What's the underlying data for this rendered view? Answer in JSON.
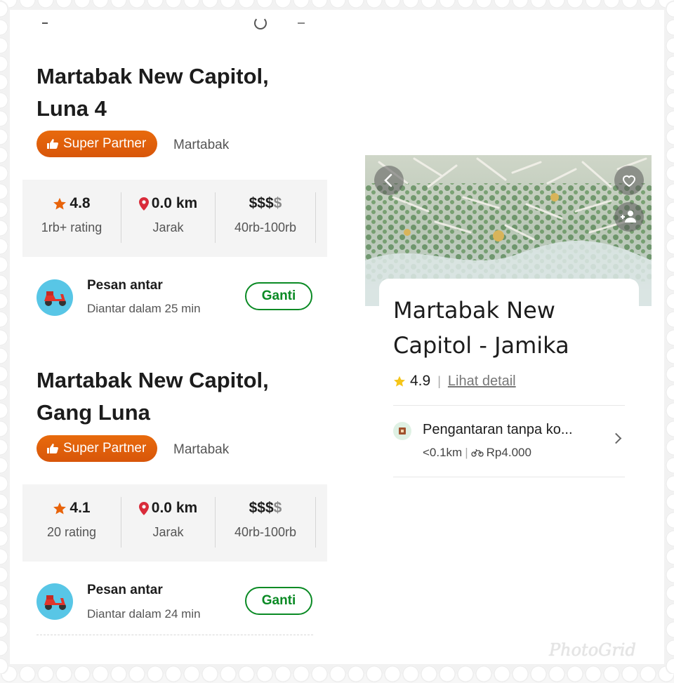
{
  "left_panel": {
    "restaurants": [
      {
        "title": "Martabak New Capitol, Luna 4",
        "badge": "Super Partner",
        "category": "Martabak",
        "rating_value": "4.8",
        "rating_label": "1rb+ rating",
        "distance_value": "0.0 km",
        "distance_label": "Jarak",
        "price_strong": "$$$",
        "price_dim": "$",
        "price_label": "40rb-100rb",
        "delivery_title": "Pesan antar",
        "delivery_sub": "Diantar dalam 25 min",
        "change_button": "Ganti"
      },
      {
        "title": "Martabak New Capitol, Gang Luna",
        "badge": "Super Partner",
        "category": "Martabak",
        "rating_value": "4.1",
        "rating_label": "20 rating",
        "distance_value": "0.0 km",
        "distance_label": "Jarak",
        "price_strong": "$$$",
        "price_dim": "$",
        "price_label": "40rb-100rb",
        "delivery_title": "Pesan antar",
        "delivery_sub": "Diantar dalam 24 min",
        "change_button": "Ganti"
      }
    ]
  },
  "right_panel": {
    "title": "Martabak New Capitol - Jamika",
    "rating": "4.9",
    "detail_link": "Lihat detail",
    "delivery_title": "Pengantaran tanpa ko...",
    "delivery_distance": "<0.1km",
    "delivery_fee": "Rp4.000"
  },
  "watermark": "PhotoGrid",
  "colors": {
    "accent_orange": "#e0600a",
    "green": "#0a8a24",
    "star_orange": "#e8630a",
    "pin_red": "#d92b3a",
    "star_yellow": "#f5c518"
  },
  "icons": [
    "back-icon",
    "heart-icon",
    "add-friend-icon",
    "thumbs-up-icon",
    "star-icon",
    "location-pin-icon",
    "scooter-icon",
    "shop-icon",
    "bike-icon",
    "chevron-right-icon",
    "search-icon"
  ]
}
